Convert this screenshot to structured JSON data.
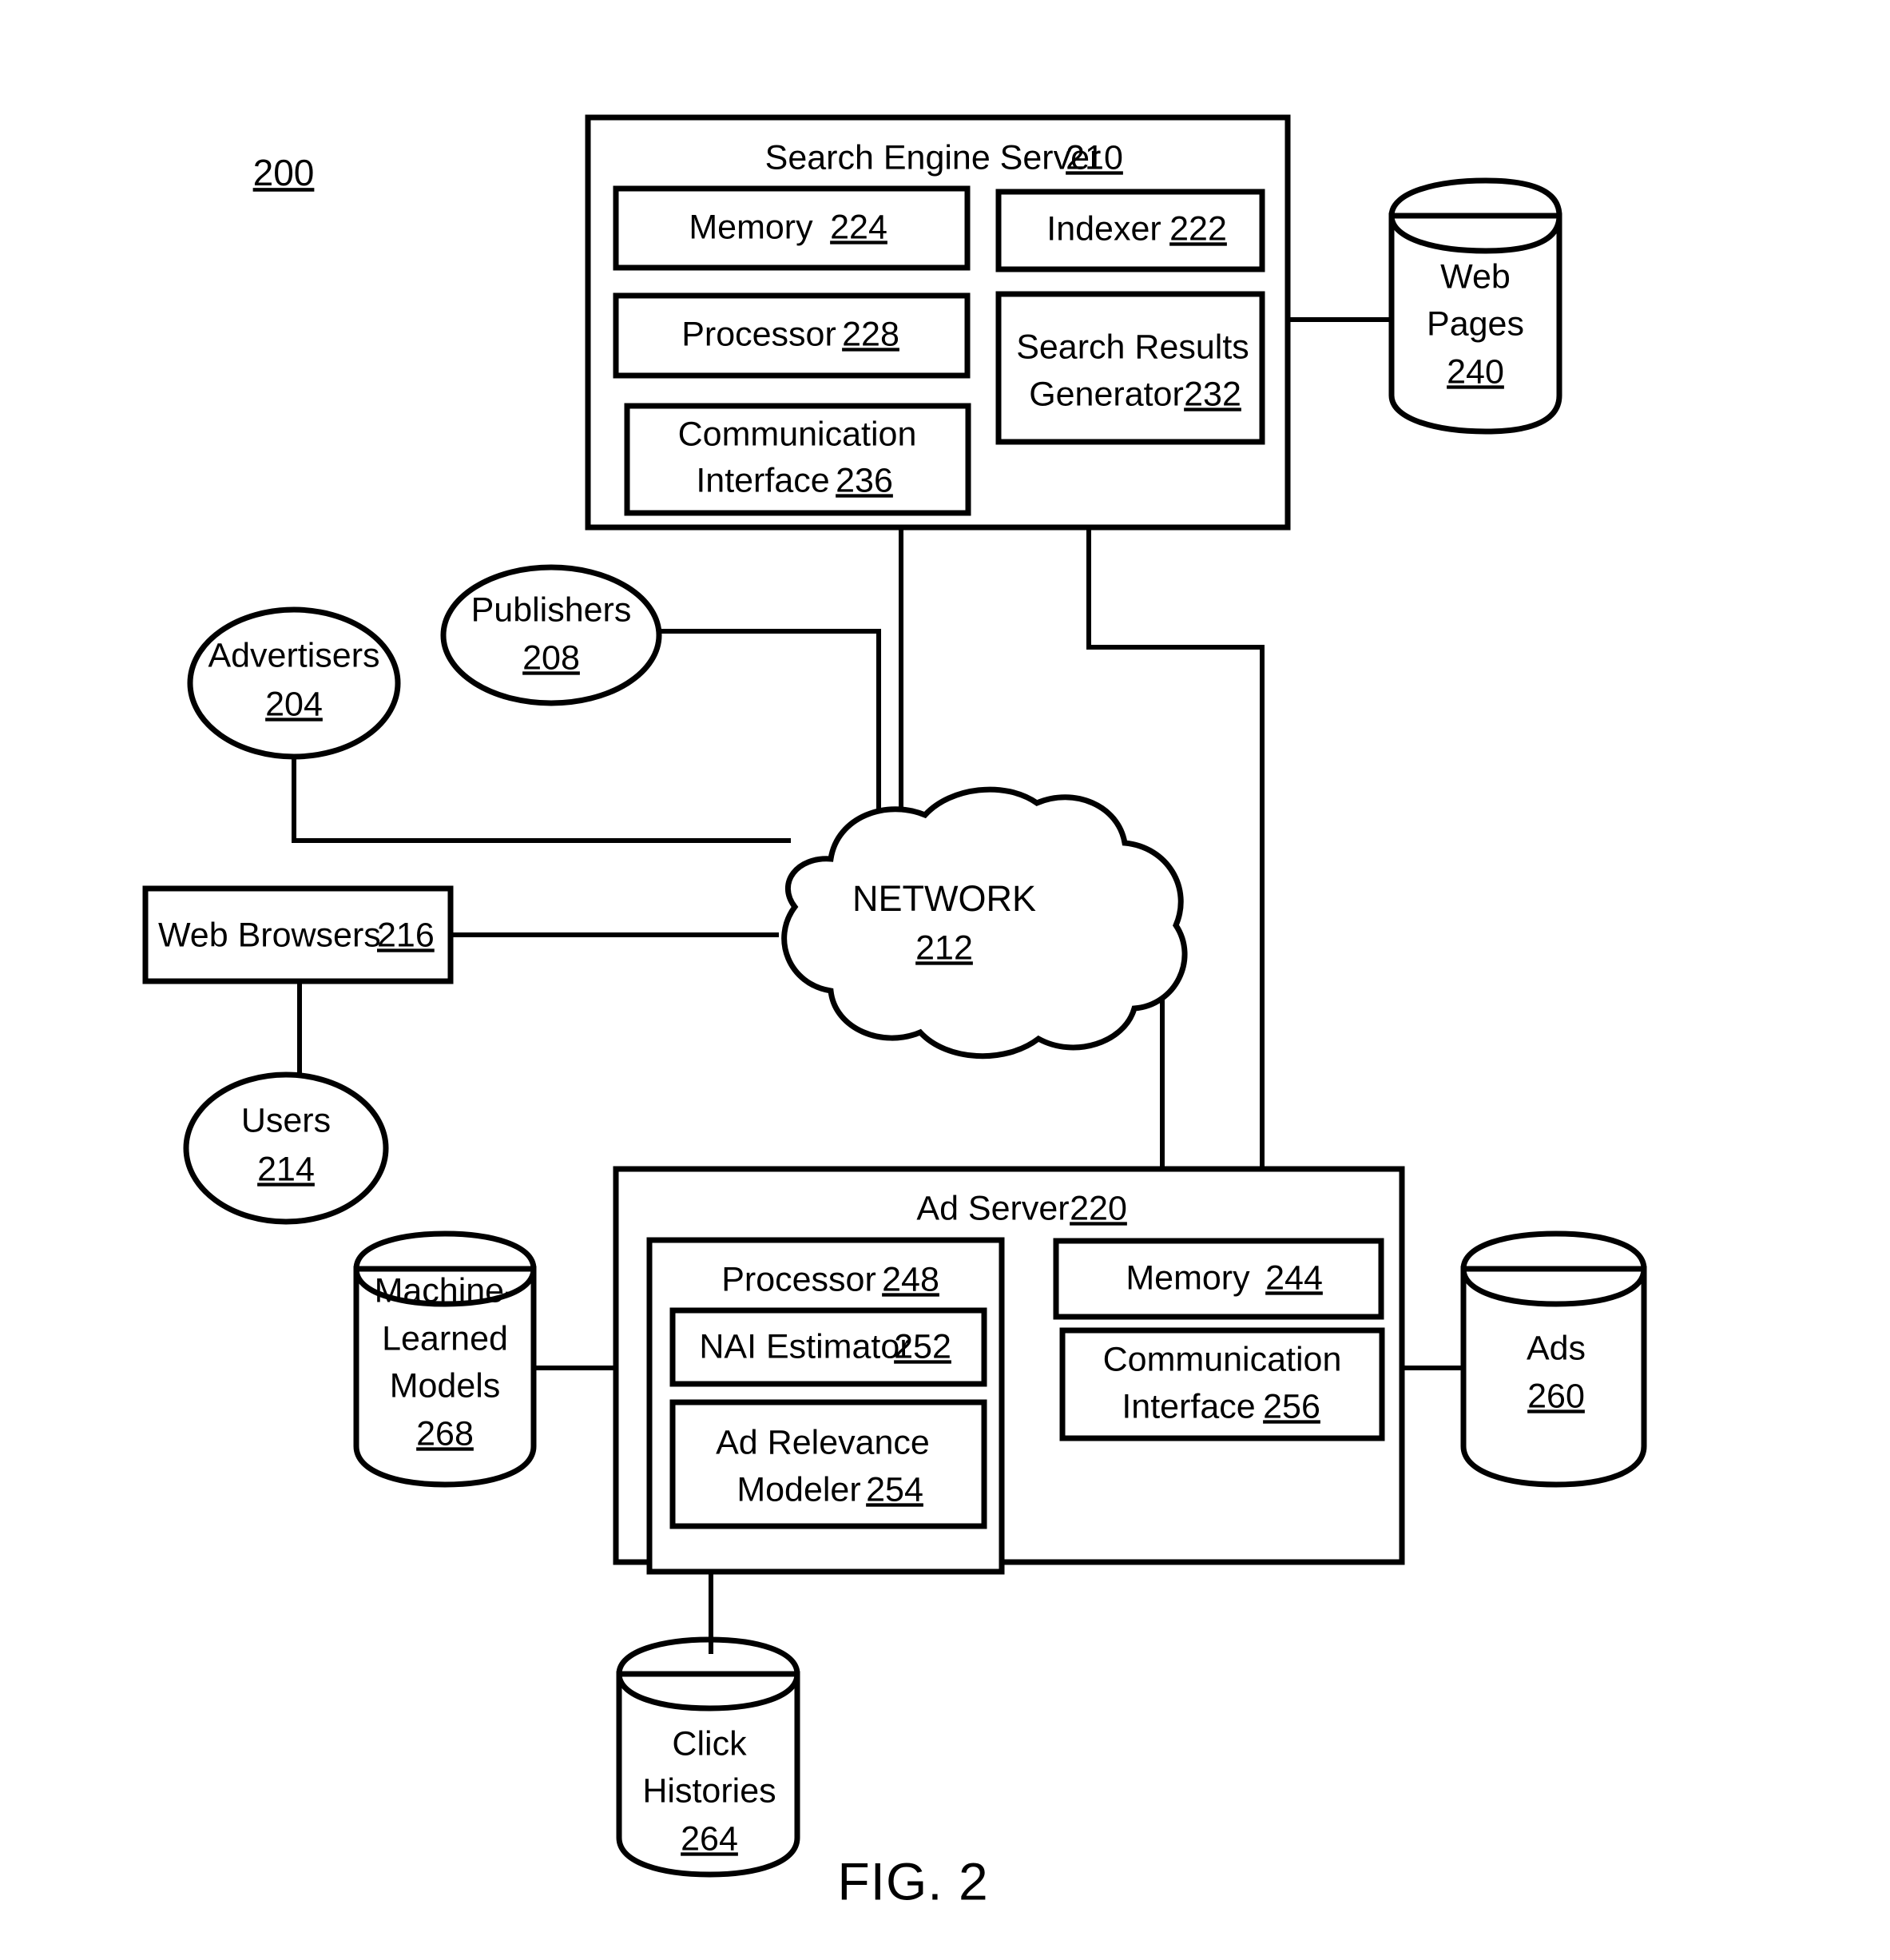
{
  "figure": {
    "caption": "FIG. 2",
    "system_ref": "200"
  },
  "search_engine_server": {
    "title": "Search Engine Server",
    "ref": "210",
    "components": [
      {
        "label": "Memory",
        "ref": "224"
      },
      {
        "label": "Indexer",
        "ref": "222"
      },
      {
        "label": "Processor",
        "ref": "228"
      },
      {
        "label": "Search Results",
        "label2": "Generator",
        "ref": "232"
      },
      {
        "label": "Communication",
        "label2": "Interface",
        "ref": "236"
      }
    ]
  },
  "ad_server": {
    "title": "Ad  Server",
    "ref": "220",
    "components": [
      {
        "label": "Processor",
        "ref": "248"
      },
      {
        "label": "NAI Estimator",
        "ref": "252"
      },
      {
        "label": "Ad Relevance",
        "label2": "Modeler",
        "ref": "254"
      },
      {
        "label": "Memory",
        "ref": "244"
      },
      {
        "label": "Communication",
        "label2": "Interface",
        "ref": "256"
      }
    ]
  },
  "entities": {
    "advertisers": {
      "label": "Advertisers",
      "ref": "204"
    },
    "publishers": {
      "label": "Publishers",
      "ref": "208"
    },
    "users": {
      "label": "Users",
      "ref": "214"
    },
    "web_browsers": {
      "label": "Web Browsers",
      "ref": "216"
    },
    "network": {
      "label": "NETWORK",
      "ref": "212"
    }
  },
  "datastores": {
    "web_pages": {
      "line1": "Web",
      "line2": "Pages",
      "ref": "240"
    },
    "machine_learned_models": {
      "line1": "Machine-",
      "line2": "Learned",
      "line3": "Models",
      "ref": "268"
    },
    "ads": {
      "line1": "Ads",
      "ref": "260"
    },
    "click_histories": {
      "line1": "Click",
      "line2": "Histories",
      "ref": "264"
    }
  },
  "colors": {
    "stroke": "#000000",
    "background": "#ffffff"
  }
}
